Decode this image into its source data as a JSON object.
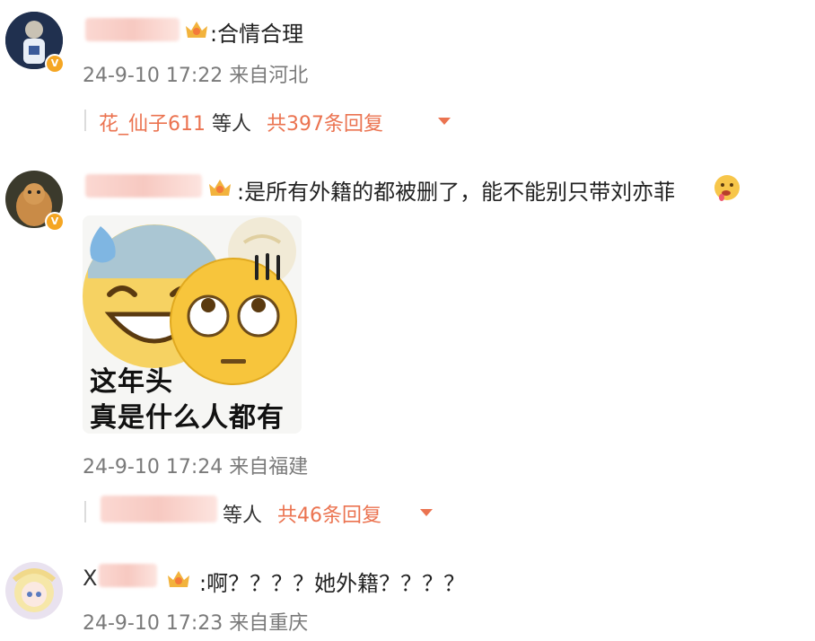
{
  "comments": [
    {
      "text": ":合情合理",
      "meta": "24-9-10 17:22 来自河北",
      "reply_user": "花_仙子611",
      "reply_suffix": " 等人",
      "reply_count": "共397条回复"
    },
    {
      "text": ":是所有外籍的都被删了，能不能别只带刘亦菲",
      "meta": "24-9-10 17:24 来自福建",
      "sticker_line1": "这年头",
      "sticker_line2": "真是什么人都有",
      "reply_suffix": "等人",
      "reply_count": "共46条回复"
    },
    {
      "name_partial": "X",
      "text": ":啊？？？？她外籍？？？？",
      "meta": "24-9-10 17:23 来自重庆"
    }
  ],
  "icons": {
    "expand": "chevron-down-icon",
    "verified": "verified-badge-icon",
    "member": "crown-badge-icon"
  },
  "colors": {
    "accent": "#eb7350",
    "meta": "#7a7a7a",
    "verified": "#f5a623"
  }
}
